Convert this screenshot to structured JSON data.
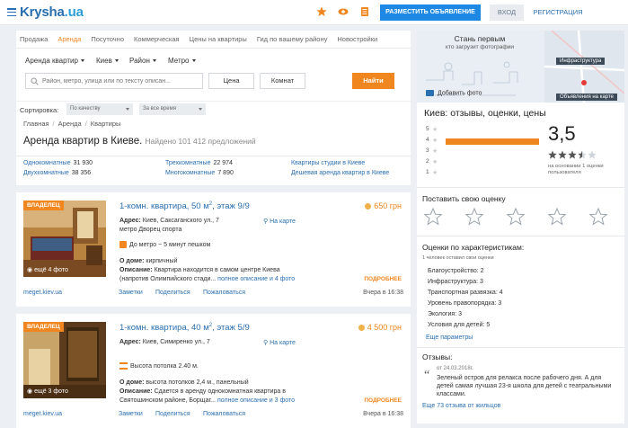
{
  "header": {
    "logo_main": "Krysha",
    "logo_tld": ".ua",
    "post_label": "РАЗМЕСТИТЬ ОБЪЯВЛЕНИЕ",
    "login_label": "ВХОД",
    "register_label": "РЕГИСТРАЦИЯ"
  },
  "nav": [
    {
      "label": "Продажа",
      "active": false
    },
    {
      "label": "Аренда",
      "active": true
    },
    {
      "label": "Посуточно",
      "active": false
    },
    {
      "label": "Коммерческая",
      "active": false
    },
    {
      "label": "Цены на квартиры",
      "active": false
    },
    {
      "label": "Гид по вашему району",
      "active": false
    },
    {
      "label": "Новостройки",
      "active": false
    }
  ],
  "filters": {
    "type": "Аренда квартир",
    "city": "Киев",
    "district": "Район",
    "metro": "Метро",
    "search_placeholder": "Район, метро, улица или по тексту описан...",
    "price_label": "Цена",
    "rooms_label": "Комнат",
    "find_label": "Найти"
  },
  "sort": {
    "label": "Сортировка:",
    "order": "По качеству",
    "period": "За все время"
  },
  "breadcrumbs": [
    "Главная",
    "Аренда",
    "Квартиры"
  ],
  "title": {
    "main": "Аренда квартир в Киеве.",
    "found": "Найдено 101 412 предложений"
  },
  "stats": [
    {
      "label": "Однокомнатные",
      "count": "31 930"
    },
    {
      "label": "Двухкомнатные",
      "count": "38 356"
    },
    {
      "label": "Трехкомнатные",
      "count": "22 974"
    },
    {
      "label": "Многокомнатные",
      "count": "7 890"
    },
    {
      "label": "Квартиры студии в Киеве",
      "count": ""
    },
    {
      "label": "Дешевая аренда квартир в Киеве",
      "count": ""
    }
  ],
  "listings": [
    {
      "owner_tag": "ВЛАДЕЛЕЦ",
      "title_prefix": "1-комн. квартира, 50 м",
      "title_sup": "2",
      "title_suffix": ", этаж 9/9",
      "price": "650 грн",
      "address_label": "Адрес:",
      "address": "Киев, Саксаганского ул., 7",
      "address2": "метро Дворец спорта",
      "map_link": "На карте",
      "feature": "До метро ~ 5 минут пешком",
      "house_label": "О доме:",
      "house": "кирпичный",
      "desc_label": "Описание:",
      "desc1": "Квартира находится в самом центре Киева",
      "desc2": "(напротив Олимпийского стади...",
      "desc_more": "полное описание и 4 фото",
      "photos": "ещё 4 фото",
      "more_tag": "ПОДРОБНЕЕ",
      "site": "meget.kiev.ua",
      "actions": [
        "Заметки",
        "Поделиться",
        "Пожаловаться"
      ],
      "date": "Вчера в 16:38"
    },
    {
      "owner_tag": "ВЛАДЕЛЕЦ",
      "title_prefix": "1-комн. квартира, 40 м",
      "title_sup": "2",
      "title_suffix": ", этаж 5/9",
      "price": "4 500 грн",
      "address_label": "Адрес:",
      "address": "Киев, Симиренко ул., 7",
      "address2": "",
      "map_link": "На карте",
      "feature": "Высота потолка 2.40 м.",
      "house_label": "О доме:",
      "house": "высота потолков 2,4 м., панельный",
      "desc_label": "Описание:",
      "desc1": "Сдается в аренду однокомнатная квартира в",
      "desc2": "Святошинском районе, Борщаг...",
      "desc_more": "полное описание и 3 фото",
      "photos": "ещё 3 фото",
      "more_tag": "ПОДРОБНЕЕ",
      "site": "meget.kiev.ua",
      "actions": [
        "Заметки",
        "Поделиться",
        "Пожаловаться"
      ],
      "date": "Вчера в 16:38"
    }
  ],
  "sidebar": {
    "banner_title": "Стань первым",
    "banner_sub": "кто загрузит фотографии",
    "chip_infra": "Инфраструктура",
    "chip_map": "Объявления на карте",
    "add_photo": "Добавить фото",
    "reviews_title": "Киев: отзывы, оценки, цены",
    "bars": [
      {
        "label": "5",
        "fraction": 0.0
      },
      {
        "label": "4",
        "fraction": 1.0
      },
      {
        "label": "3",
        "fraction": 0.0
      },
      {
        "label": "2",
        "fraction": 0.0
      },
      {
        "label": "1",
        "fraction": 0.0
      }
    ],
    "avg": "3,5",
    "avg_stars_value": 3.5,
    "avg_note": "на основании 1 оценки пользователя",
    "rate_title": "Поставить свою оценку",
    "char_title": "Оценки по характеристикам:",
    "char_sub": "1 человек оставил свои оценки",
    "chars": [
      "Благоустройство: 2",
      "Инфраструктура: 3",
      "Транспортная развязка: 4",
      "Уровень правопорядка: 3",
      "Экология: 3",
      "Условия для детей: 5"
    ],
    "char_more": "Еще параметры",
    "reviews_label": "Отзывы:",
    "review_date": "от 24.03.2018г.",
    "review_text": "Зеленый остров для релакса после рабочего дня. А для детей самая лучшая 23-я школа для детей с театральными классами.",
    "reviews_more": "Еще 73 отзыва от жильцов"
  },
  "colors": {
    "brand_blue": "#2a6fb0",
    "accent_orange": "#f0861f",
    "button_blue": "#1e88e5"
  }
}
